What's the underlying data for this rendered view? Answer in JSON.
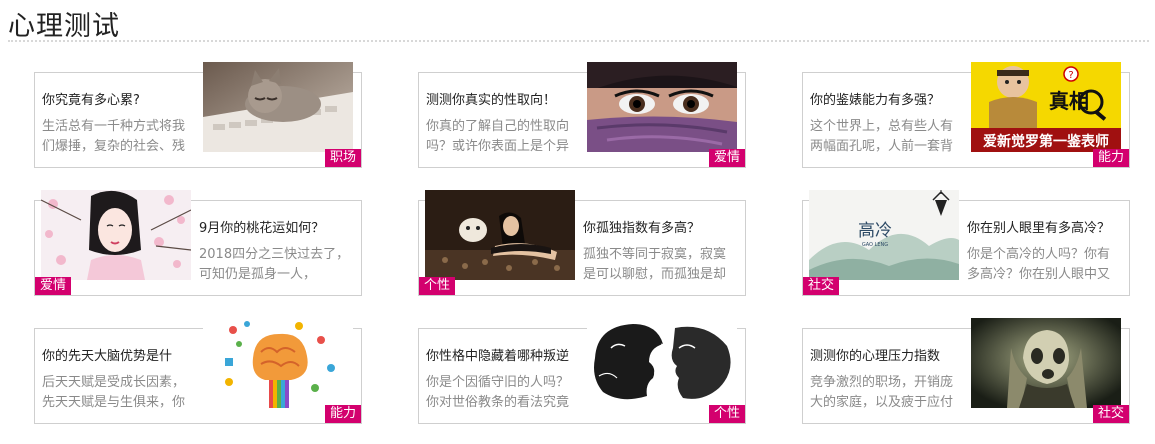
{
  "section": {
    "title": "心理测试"
  },
  "cards": [
    {
      "title": "你究竟有多心累?",
      "desc": "生活总有一千种方式将我们爆捶，复杂的社会、残",
      "tag": "职场",
      "image": "kitten-on-keyboard"
    },
    {
      "title": "测测你真实的性取向！",
      "desc": "你真的了解自己的性取向吗？或许你表面上是个异",
      "tag": "爱情",
      "image": "woman-eyes-veil"
    },
    {
      "title": "你的鉴婊能力有多强？",
      "desc": "这个世界上，总有些人有两幅面孔呢，人前一套背",
      "tag": "能力",
      "image": "detective-meme-banner"
    },
    {
      "title": "9月你的桃花运如何？",
      "desc": "2018四分之三快过去了，可知仍是孤身一人，",
      "tag": "爱情",
      "image": "woman-cherry-blossoms"
    },
    {
      "title": "你孤独指数有多高？",
      "desc": "孤独不等同于寂寞，寂寞是可以聊慰，而孤独是却",
      "tag": "个性",
      "image": "woman-with-dog"
    },
    {
      "title": "你在别人眼里有多高冷？",
      "desc": "你是个高冷的人吗？你有多高冷？你在别人眼中又",
      "tag": "社交",
      "image": "ink-landscape"
    },
    {
      "title": "你的先天大脑优势是什",
      "desc": "后天天赋是受成长因素，先天天赋是与生俱来，你",
      "tag": "能力",
      "image": "colorful-brain"
    },
    {
      "title": "你性格中隐藏着哪种叛逆",
      "desc": "你是个因循守旧的人吗？你对世俗教条的看法究竟",
      "tag": "个性",
      "image": "silhouette-faces"
    },
    {
      "title": "测测你的心理压力指数",
      "desc": "竞争激烈的职场，开销庞大的家庭，以及疲于应付",
      "tag": "社交",
      "image": "stressed-man"
    }
  ],
  "banner_text": {
    "big": "真相",
    "caption": "爱新觉罗第一鉴表师"
  },
  "ink_text": {
    "title": "高冷",
    "subtitle": "GAO LENG"
  },
  "colors": {
    "tag_bg": "#d3006e",
    "border": "#cfcfcf",
    "desc": "#8a8a8a"
  }
}
